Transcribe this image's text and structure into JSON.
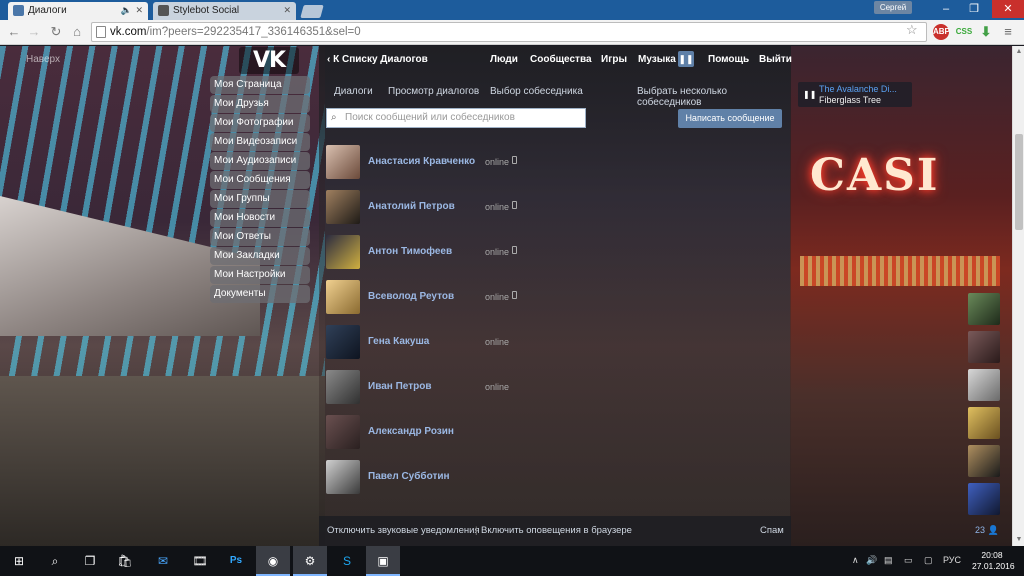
{
  "browser": {
    "tabs": [
      {
        "title": "Диалоги",
        "audio_icon": "speaker-icon",
        "active": true
      },
      {
        "title": "Stylebot Social",
        "active": false
      }
    ],
    "user": "Сергей",
    "window_buttons": [
      "–",
      "❐",
      "✕"
    ],
    "url_host": "vk.com",
    "url_rest": "/im?peers=292235417_336146351&sel=0",
    "extensions": [
      {
        "name": "abp-icon",
        "label": "ABP",
        "color": "#c9302c"
      },
      {
        "name": "css-icon",
        "label": "CSS",
        "color": "#38a838"
      },
      {
        "name": "download-icon",
        "label": "⬇",
        "color": "#43a047"
      }
    ]
  },
  "left_menu": {
    "back_top": "Наверх",
    "items": [
      "Моя Страница",
      "Мои Друзья",
      "Мои Фотографии",
      "Мои Видеозаписи",
      "Мои Аудиозаписи",
      "Мои Сообщения",
      "Мои Группы",
      "Мои Новости",
      "Мои Ответы",
      "Мои Закладки",
      "Мои Настройки",
      "Документы"
    ]
  },
  "header": {
    "logo": "VK",
    "back_link": "К Списку Диалогов",
    "nav": [
      "Люди",
      "Сообщества",
      "Игры",
      "Музыка",
      "Помощь",
      "Выйти"
    ]
  },
  "subnav": {
    "tabs": [
      "Диалоги",
      "Просмотр диалогов",
      "Выбор собеседника"
    ],
    "select_multiple": "Выбрать несколько собеседников"
  },
  "search": {
    "placeholder": "Поиск сообщений или собеседников"
  },
  "write_button": "Написать сообщение",
  "dialogs": [
    {
      "name": "Анастасия Кравченко",
      "status": "online",
      "mobile": true
    },
    {
      "name": "Анатолий Петров",
      "status": "online",
      "mobile": true
    },
    {
      "name": "Антон Тимофеев",
      "status": "online",
      "mobile": true
    },
    {
      "name": "Всеволод Реутов",
      "status": "online",
      "mobile": true
    },
    {
      "name": "Гена Какуша",
      "status": "online",
      "mobile": false
    },
    {
      "name": "Иван Петров",
      "status": "online",
      "mobile": false
    },
    {
      "name": "Александр Розин",
      "status": "",
      "mobile": false
    },
    {
      "name": "Павел Субботин",
      "status": "",
      "mobile": false
    }
  ],
  "footer": {
    "mute": "Отключить звуковые уведомления",
    "separator": "|",
    "browser_notify": "Включить оповещения в браузере",
    "spam": "Спам"
  },
  "player": {
    "artist": "The Avalanche Di...",
    "track": "Fiberglass Tree"
  },
  "friends_online": {
    "count": "23"
  },
  "background": {
    "sign": "CASI"
  },
  "taskbar": {
    "lang": "РУС",
    "time": "20:08",
    "date": "27.01.2016"
  }
}
